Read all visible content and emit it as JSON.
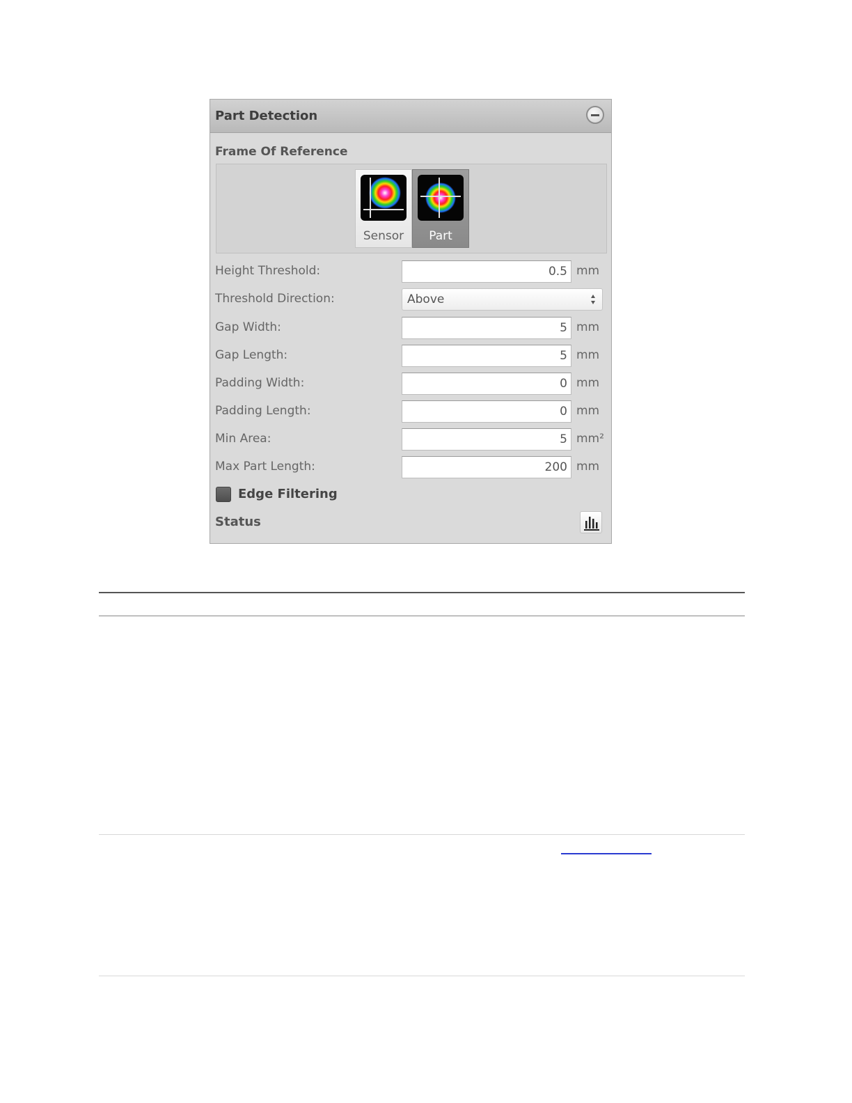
{
  "panel": {
    "title": "Part Detection",
    "frame_of_reference": {
      "label": "Frame Of Reference",
      "options": [
        {
          "label": "Sensor",
          "selected": false
        },
        {
          "label": "Part",
          "selected": true
        }
      ]
    },
    "fields": [
      {
        "label": "Height Threshold:",
        "value": "0.5",
        "unit": "mm"
      },
      {
        "label": "Gap Width:",
        "value": "5",
        "unit": "mm"
      },
      {
        "label": "Gap Length:",
        "value": "5",
        "unit": "mm"
      },
      {
        "label": "Padding Width:",
        "value": "0",
        "unit": "mm"
      },
      {
        "label": "Padding Length:",
        "value": "0",
        "unit": "mm"
      },
      {
        "label": "Min Area:",
        "value": "5",
        "unit": "mm²"
      },
      {
        "label": "Max Part Length:",
        "value": "200",
        "unit": "mm"
      }
    ],
    "threshold_direction": {
      "label": "Threshold Direction:",
      "value": "Above"
    },
    "edge_filtering": {
      "label": "Edge Filtering",
      "checked": false
    },
    "status": {
      "label": "Status",
      "icon": "bar-chart-icon"
    }
  },
  "colors": {
    "panel_bg": "#dadada",
    "header_bg": "#c4c4c4",
    "selected_option": "#8e8e8e",
    "link": "#2a3bd1"
  }
}
